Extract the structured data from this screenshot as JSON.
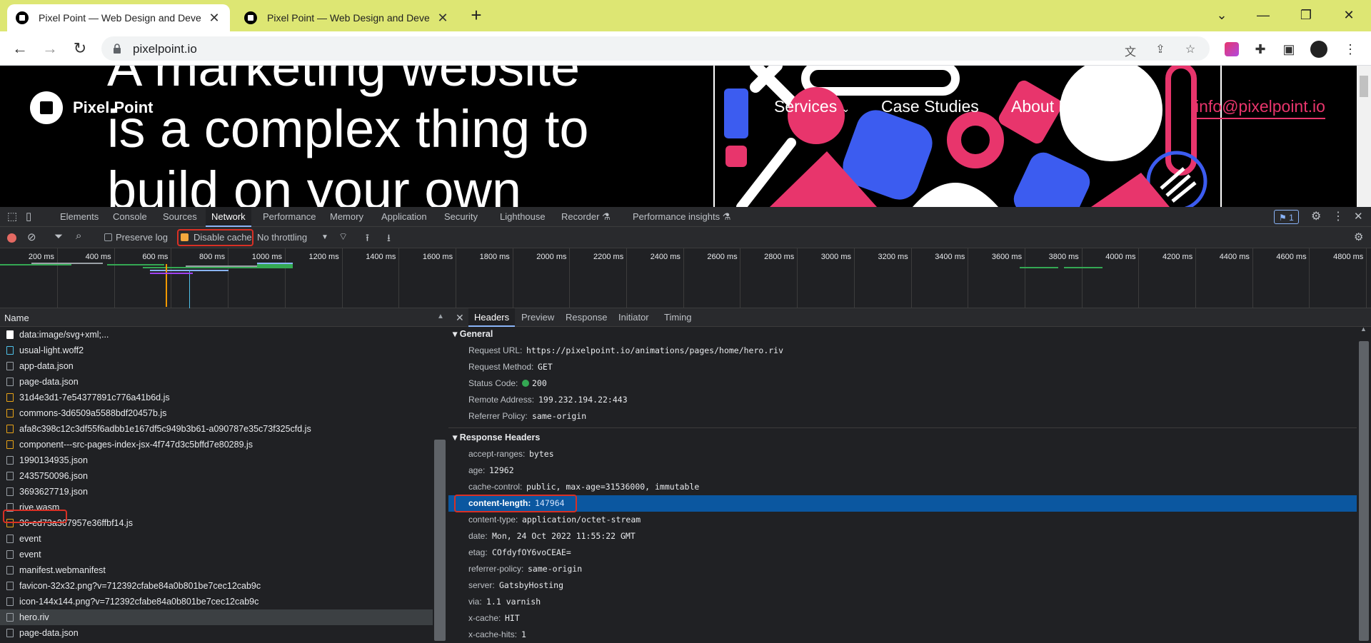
{
  "browser": {
    "tabs": [
      {
        "title": "Pixel Point — Web Design and Deve",
        "active": true
      },
      {
        "title": "Pixel Point — Web Design and Deve",
        "active": false
      }
    ],
    "url": "pixelpoint.io"
  },
  "site": {
    "brand": "Pixel Point",
    "hero_lines": [
      "A marketing website",
      "is a complex thing to",
      "build on your own"
    ],
    "nav": {
      "services": "Services",
      "case_studies": "Case Studies",
      "about": "About U",
      "email": "info@pixelpoint.io"
    }
  },
  "devtools": {
    "tabs": [
      "Elements",
      "Console",
      "Sources",
      "Network",
      "Performance",
      "Memory",
      "Application",
      "Security",
      "Lighthouse",
      "Recorder",
      "Performance insights"
    ],
    "active_tab": "Network",
    "issues_badge": "1",
    "controls": {
      "preserve_log": "Preserve log",
      "disable_cache": "Disable cache",
      "throttling": "No throttling"
    },
    "timeline_ticks": [
      "200 ms",
      "400 ms",
      "600 ms",
      "800 ms",
      "1000 ms",
      "1200 ms",
      "1400 ms",
      "1600 ms",
      "1800 ms",
      "2000 ms",
      "2200 ms",
      "2400 ms",
      "2600 ms",
      "2800 ms",
      "3000 ms",
      "3200 ms",
      "3400 ms",
      "3600 ms",
      "3800 ms",
      "4000 ms",
      "4200 ms",
      "4400 ms",
      "4600 ms",
      "4800 ms"
    ],
    "list_header": "Name",
    "requests": [
      {
        "name": "data:image/svg+xml;...",
        "kind": "img"
      },
      {
        "name": "usual-light.woff2",
        "kind": "font"
      },
      {
        "name": "app-data.json",
        "kind": "doc"
      },
      {
        "name": "page-data.json",
        "kind": "doc"
      },
      {
        "name": "31d4e3d1-7e54377891c776a41b6d.js",
        "kind": "js"
      },
      {
        "name": "commons-3d6509a5588bdf20457b.js",
        "kind": "js"
      },
      {
        "name": "afa8c398c12c3df55f6adbb1e167df5c949b3b61-a090787e35c73f325cfd.js",
        "kind": "js"
      },
      {
        "name": "component---src-pages-index-jsx-4f747d3c5bffd7e80289.js",
        "kind": "js"
      },
      {
        "name": "1990134935.json",
        "kind": "doc"
      },
      {
        "name": "2435750096.json",
        "kind": "doc"
      },
      {
        "name": "3693627719.json",
        "kind": "doc"
      },
      {
        "name": "rive.wasm",
        "kind": "doc"
      },
      {
        "name": "36-ed73a367957e36ffbf14.js",
        "kind": "js"
      },
      {
        "name": "event",
        "kind": "doc"
      },
      {
        "name": "event",
        "kind": "doc"
      },
      {
        "name": "manifest.webmanifest",
        "kind": "doc"
      },
      {
        "name": "favicon-32x32.png?v=712392cfabe84a0b801be7cec12cab9c",
        "kind": "doc"
      },
      {
        "name": "icon-144x144.png?v=712392cfabe84a0b801be7cec12cab9c",
        "kind": "doc"
      },
      {
        "name": "hero.riv",
        "kind": "doc",
        "selected": true
      },
      {
        "name": "page-data.json",
        "kind": "doc"
      }
    ],
    "detail_tabs": [
      "Headers",
      "Preview",
      "Response",
      "Initiator",
      "Timing"
    ],
    "general": {
      "title": "General",
      "rows": [
        {
          "k": "Request URL:",
          "v": "https://pixelpoint.io/animations/pages/home/hero.riv"
        },
        {
          "k": "Request Method:",
          "v": "GET"
        },
        {
          "k": "Status Code:",
          "v": "200"
        },
        {
          "k": "Remote Address:",
          "v": "199.232.194.22:443"
        },
        {
          "k": "Referrer Policy:",
          "v": "same-origin"
        }
      ]
    },
    "response": {
      "title": "Response Headers",
      "rows": [
        {
          "k": "accept-ranges:",
          "v": "bytes"
        },
        {
          "k": "age:",
          "v": "12962"
        },
        {
          "k": "cache-control:",
          "v": "public, max-age=31536000, immutable"
        },
        {
          "k": "content-length:",
          "v": "147964",
          "selected": true
        },
        {
          "k": "content-type:",
          "v": "application/octet-stream"
        },
        {
          "k": "date:",
          "v": "Mon, 24 Oct 2022 11:55:22 GMT"
        },
        {
          "k": "etag:",
          "v": "COfdyfOY6voCEAE="
        },
        {
          "k": "referrer-policy:",
          "v": "same-origin"
        },
        {
          "k": "server:",
          "v": "GatsbyHosting"
        },
        {
          "k": "via:",
          "v": "1.1 varnish"
        },
        {
          "k": "x-cache:",
          "v": "HIT"
        },
        {
          "k": "x-cache-hits:",
          "v": "1"
        }
      ]
    }
  },
  "colors": {
    "tabstrip": "#dde673",
    "accent_pink": "#e8356c",
    "accent_blue": "#3c5cf0",
    "selection": "#0b57a0",
    "highlight_box": "#d93025"
  }
}
